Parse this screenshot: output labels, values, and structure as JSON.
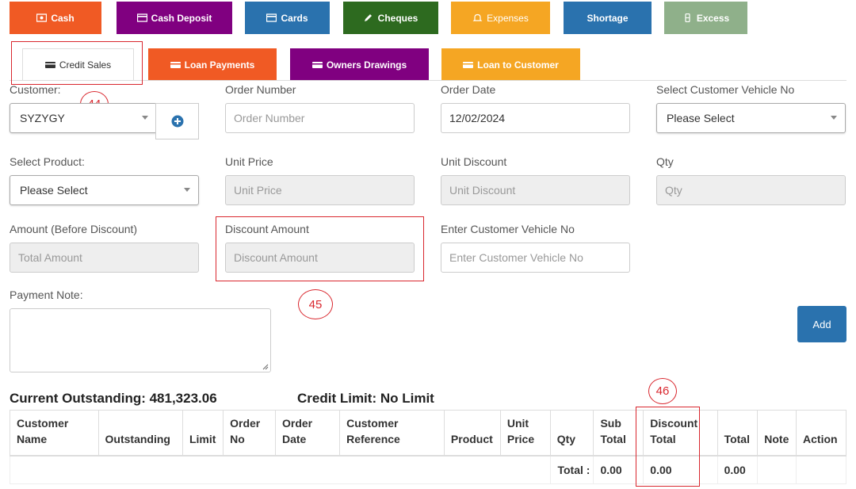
{
  "tabs_row1": [
    {
      "label": "Cash",
      "icon": "money-icon",
      "color": "#f05a24"
    },
    {
      "label": "Cash Deposit",
      "icon": "card-icon",
      "color": "#800080"
    },
    {
      "label": "Cards",
      "icon": "card-icon",
      "color": "#2a72ae"
    },
    {
      "label": "Cheques",
      "icon": "pencil-icon",
      "color": "#2d6a1f"
    },
    {
      "label": "Expenses",
      "icon": "bell-icon",
      "color": "#f5a623"
    },
    {
      "label": "Shortage",
      "icon": "",
      "color": "#2a72ae"
    },
    {
      "label": "Excess",
      "icon": "money-bill-icon",
      "color": "#8fb08a"
    }
  ],
  "tabs_row2": [
    {
      "label": "Credit Sales",
      "icon": "card-icon",
      "color": "#ffffff"
    },
    {
      "label": "Loan Payments",
      "icon": "card-icon",
      "color": "#f05a24"
    },
    {
      "label": "Owners Drawings",
      "icon": "card-icon",
      "color": "#800080"
    },
    {
      "label": "Loan to Customer",
      "icon": "card-icon",
      "color": "#f5a623"
    }
  ],
  "form": {
    "customer_label": "Customer:",
    "customer_value": "SYZYGY",
    "order_number_label": "Order Number",
    "order_number_placeholder": "Order Number",
    "order_date_label": "Order Date",
    "order_date_value": "12/02/2024",
    "vehicle_select_label": "Select Customer Vehicle No",
    "vehicle_select_value": "Please Select",
    "product_label": "Select Product:",
    "product_value": "Please Select",
    "unit_price_label": "Unit Price",
    "unit_price_placeholder": "Unit Price",
    "unit_discount_label": "Unit Discount",
    "unit_discount_placeholder": "Unit Discount",
    "qty_label": "Qty",
    "qty_placeholder": "Qty",
    "amount_label": "Amount (Before Discount)",
    "amount_placeholder": "Total Amount",
    "discount_amount_label": "Discount Amount",
    "discount_amount_placeholder": "Discount Amount",
    "vehicle_enter_label": "Enter Customer Vehicle No",
    "vehicle_enter_placeholder": "Enter Customer Vehicle No",
    "payment_note_label": "Payment Note:",
    "add_label": "Add"
  },
  "annotations": {
    "a44": "44",
    "a45": "45",
    "a46": "46"
  },
  "summary": {
    "outstanding": "Current Outstanding: 481,323.06",
    "credit_limit": "Credit Limit: No Limit"
  },
  "table": {
    "headers": [
      "Customer Name",
      "Outstanding",
      "Limit",
      "Order No",
      "Order Date",
      "Customer Reference",
      "Product",
      "Unit Price",
      "Qty",
      "Sub Total",
      "Discount Total",
      "Total",
      "Note",
      "Action"
    ],
    "total_label": "Total :",
    "sub_total": "0.00",
    "discount_total": "0.00",
    "total": "0.00"
  },
  "colors": {
    "accent": "#2a72ae",
    "annotation": "#d9272e"
  }
}
